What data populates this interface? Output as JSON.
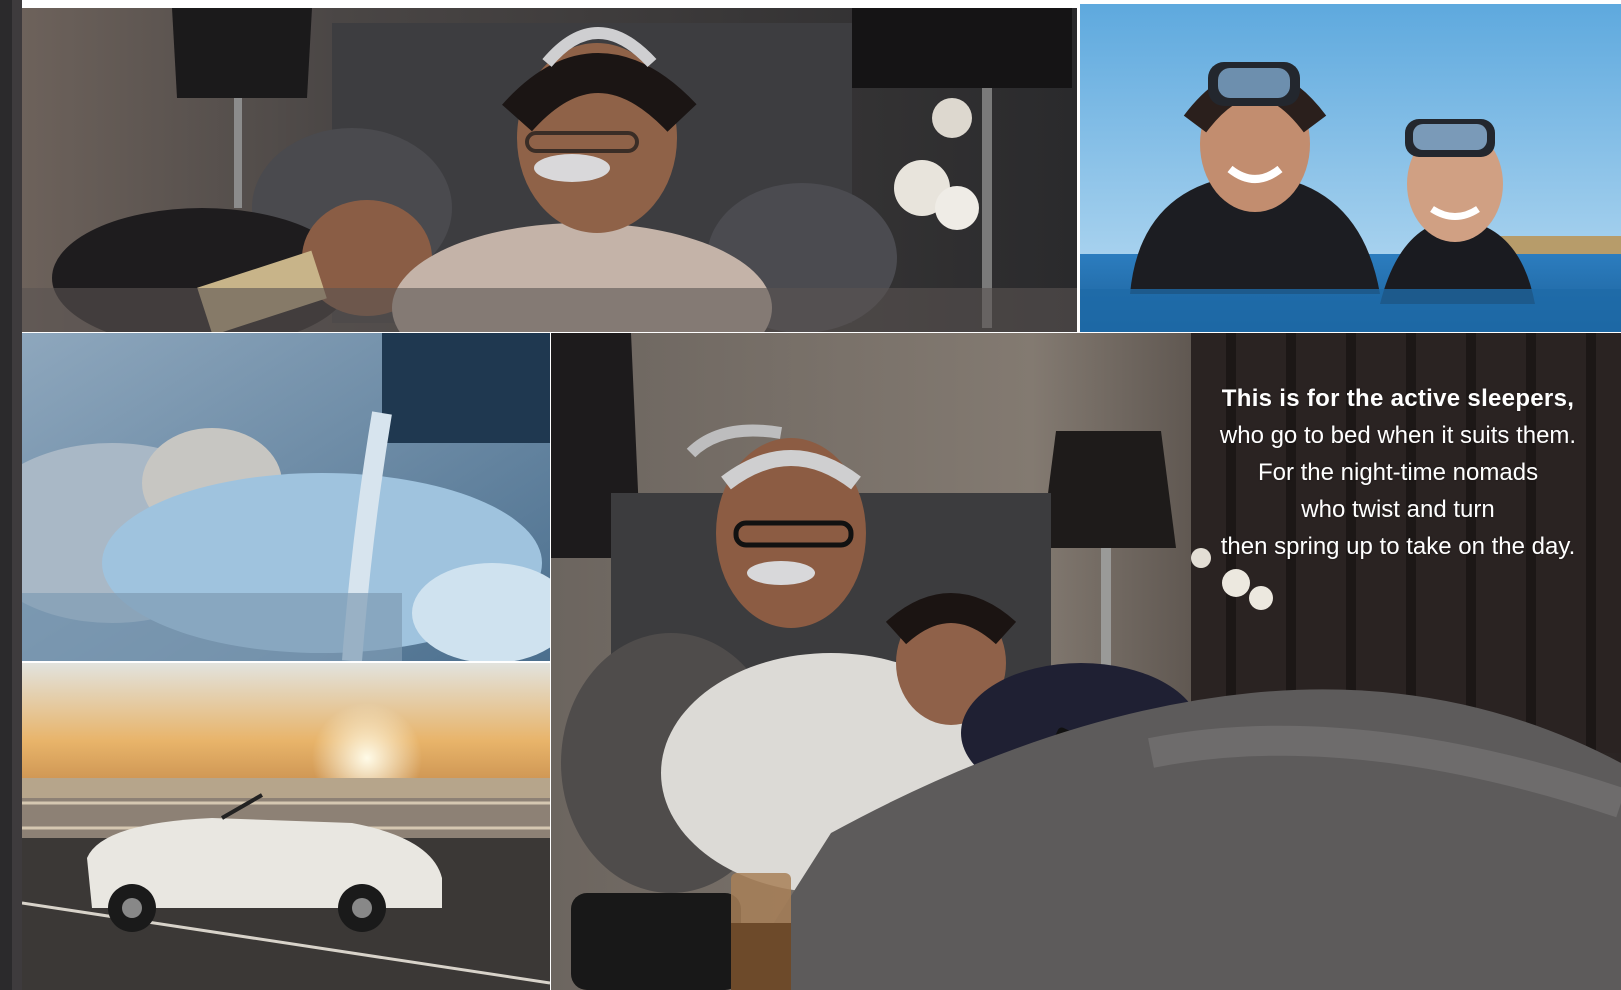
{
  "copy": {
    "headline": "This is for the active sleepers,",
    "lines": [
      "who go to bed when it suits them.",
      "For the night-time nomads",
      "who twist and turn",
      "then spring up to take on the day."
    ]
  },
  "colors": {
    "text": "#ffffff",
    "sea": "#1f6fb0",
    "sky": "#5ea9de",
    "sunset": "#e8b46a",
    "headboard": "#3c3c3e"
  }
}
